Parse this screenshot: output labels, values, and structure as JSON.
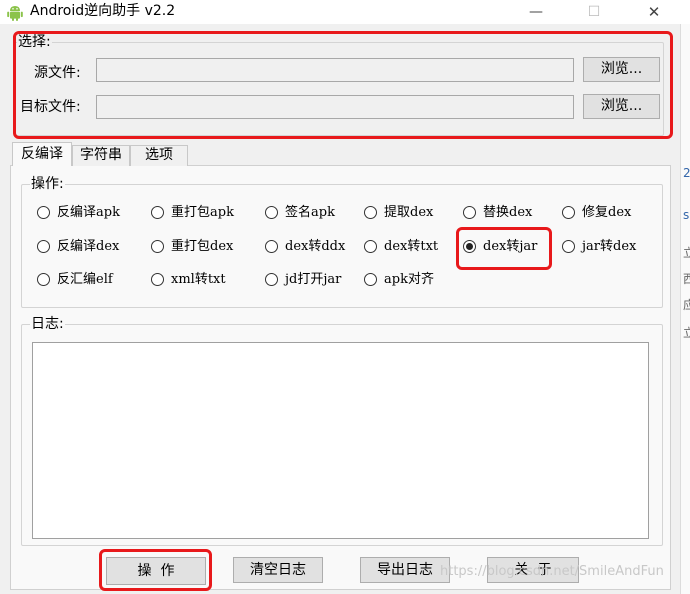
{
  "window": {
    "title": "Android逆向助手 v2.2",
    "controls": {
      "minimize": "—",
      "maximize": "☐",
      "close": "✕"
    }
  },
  "select_group": {
    "legend": "选择:",
    "source_label": "源文件:",
    "source_value": "",
    "target_label": "目标文件:",
    "target_value": "",
    "browse_label": "浏览..."
  },
  "tabs": [
    {
      "label": "反编译",
      "active": true
    },
    {
      "label": "字符串",
      "active": false
    },
    {
      "label": "选项",
      "active": false
    }
  ],
  "operation_group": {
    "legend": "操作:",
    "options": [
      {
        "label": "反编译apk",
        "checked": false
      },
      {
        "label": "重打包apk",
        "checked": false
      },
      {
        "label": "签名apk",
        "checked": false
      },
      {
        "label": "提取dex",
        "checked": false
      },
      {
        "label": "替换dex",
        "checked": false
      },
      {
        "label": "修复dex",
        "checked": false
      },
      {
        "label": "反编译dex",
        "checked": false
      },
      {
        "label": "重打包dex",
        "checked": false
      },
      {
        "label": "dex转ddx",
        "checked": false
      },
      {
        "label": "dex转txt",
        "checked": false
      },
      {
        "label": "dex转jar",
        "checked": true
      },
      {
        "label": "jar转dex",
        "checked": false
      },
      {
        "label": "反汇编elf",
        "checked": false
      },
      {
        "label": "xml转txt",
        "checked": false
      },
      {
        "label": "jd打开jar",
        "checked": false
      },
      {
        "label": "apk对齐",
        "checked": false
      }
    ]
  },
  "log_group": {
    "legend": "日志:",
    "content": ""
  },
  "buttons": {
    "operate": "操  作",
    "clear_log": "清空日志",
    "export_log": "导出日志",
    "about": "关  于"
  },
  "watermark": "https://blog.csdn.net/SmileAndFun",
  "right_strip": [
    "2",
    "s",
    "立",
    "西",
    "应",
    "立"
  ],
  "colors": {
    "highlight": "#e8191b",
    "background": "#f0f0f0",
    "android_green": "#8bc34a"
  }
}
